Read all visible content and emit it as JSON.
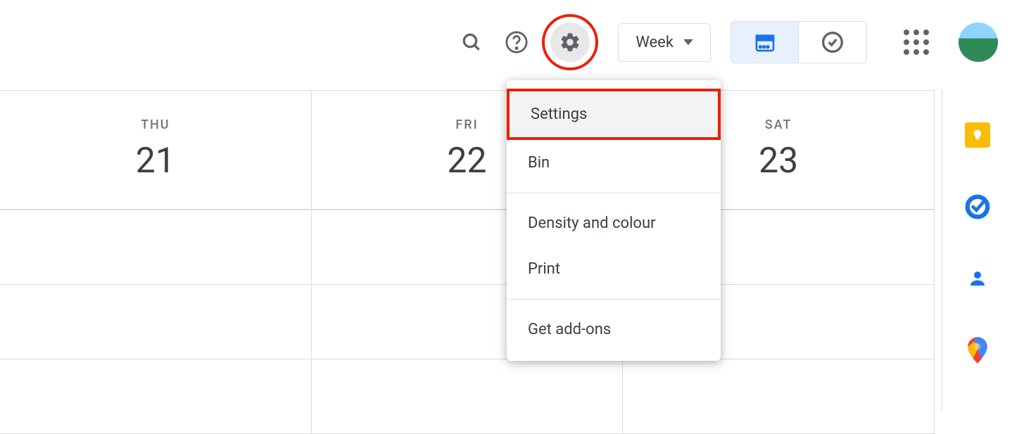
{
  "header": {
    "view_selector_label": "Week"
  },
  "calendar": {
    "days": [
      {
        "name": "THU",
        "num": "21"
      },
      {
        "name": "FRI",
        "num": "22"
      },
      {
        "name": "SAT",
        "num": "23"
      }
    ]
  },
  "settings_menu": {
    "items": [
      {
        "label": "Settings",
        "highlighted": true
      },
      {
        "label": "Bin",
        "divider_after": true
      },
      {
        "label": "Density and colour"
      },
      {
        "label": "Print",
        "divider_after": true
      },
      {
        "label": "Get add-ons"
      }
    ]
  }
}
